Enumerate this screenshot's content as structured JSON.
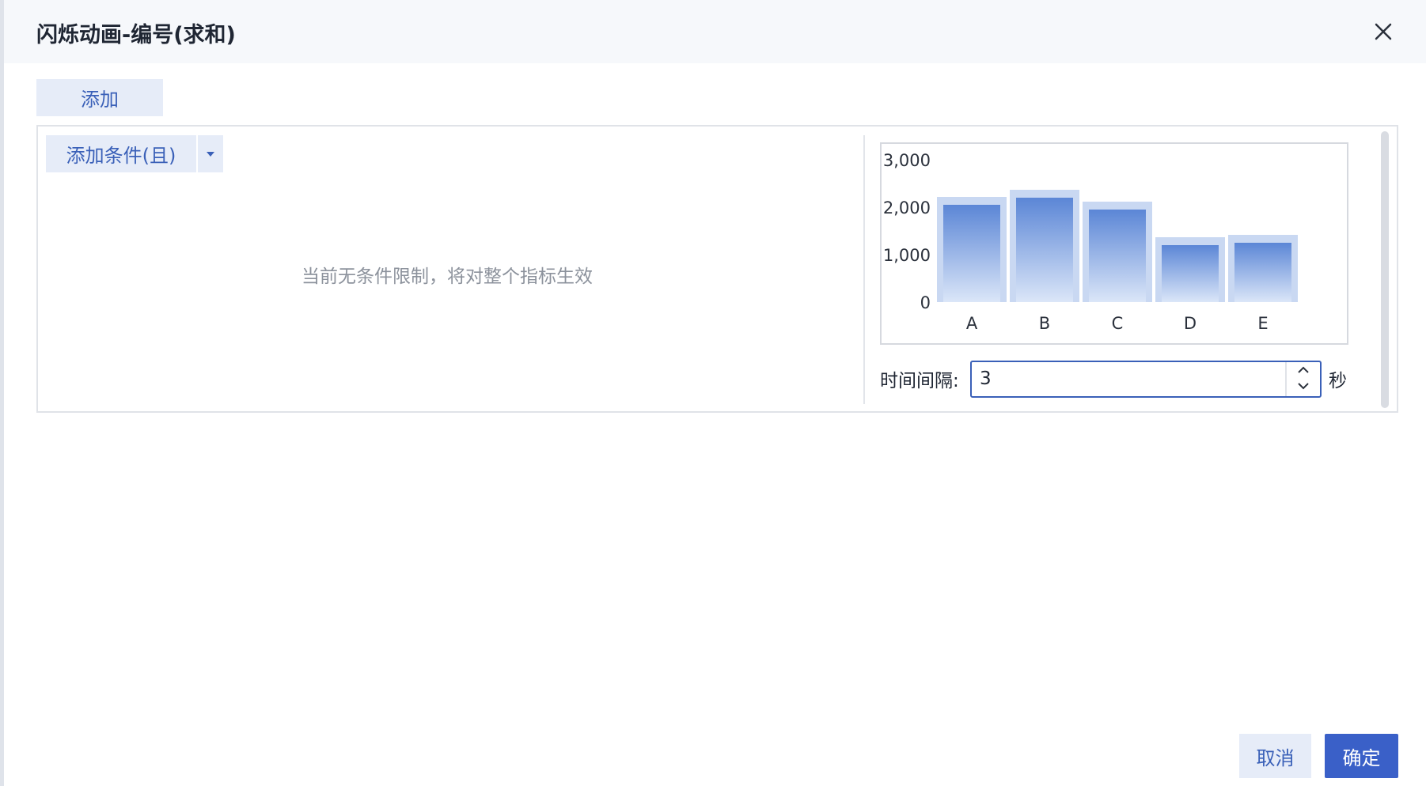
{
  "dialog": {
    "title": "闪烁动画-编号(求和)",
    "close_icon": "close-icon"
  },
  "toolbar": {
    "add_label": "添加"
  },
  "conditions": {
    "add_condition_label": "添加条件(且)",
    "dropdown_icon": "caret-down-icon",
    "empty_message": "当前无条件限制，将对整个指标生效"
  },
  "preview": {
    "interval_label": "时间间隔:",
    "interval_value": "3",
    "interval_unit": "秒",
    "spinner_icons": [
      "chevron-up-icon",
      "chevron-down-icon"
    ]
  },
  "chart_data": {
    "type": "bar",
    "categories": [
      "A",
      "B",
      "C",
      "D",
      "E"
    ],
    "values": [
      2050,
      2200,
      1950,
      1200,
      1250
    ],
    "y_ticks": [
      "0",
      "1,000",
      "2,000",
      "3,000"
    ],
    "ylim": [
      0,
      3000
    ],
    "bar_color": "#5b86d6",
    "glow_color": "#c9d8f2"
  },
  "footer": {
    "cancel_label": "取消",
    "ok_label": "确定"
  },
  "colors": {
    "accent": "#3a60c8",
    "button_light": "#e6ecf8",
    "header_bg": "#f6f8fb"
  }
}
